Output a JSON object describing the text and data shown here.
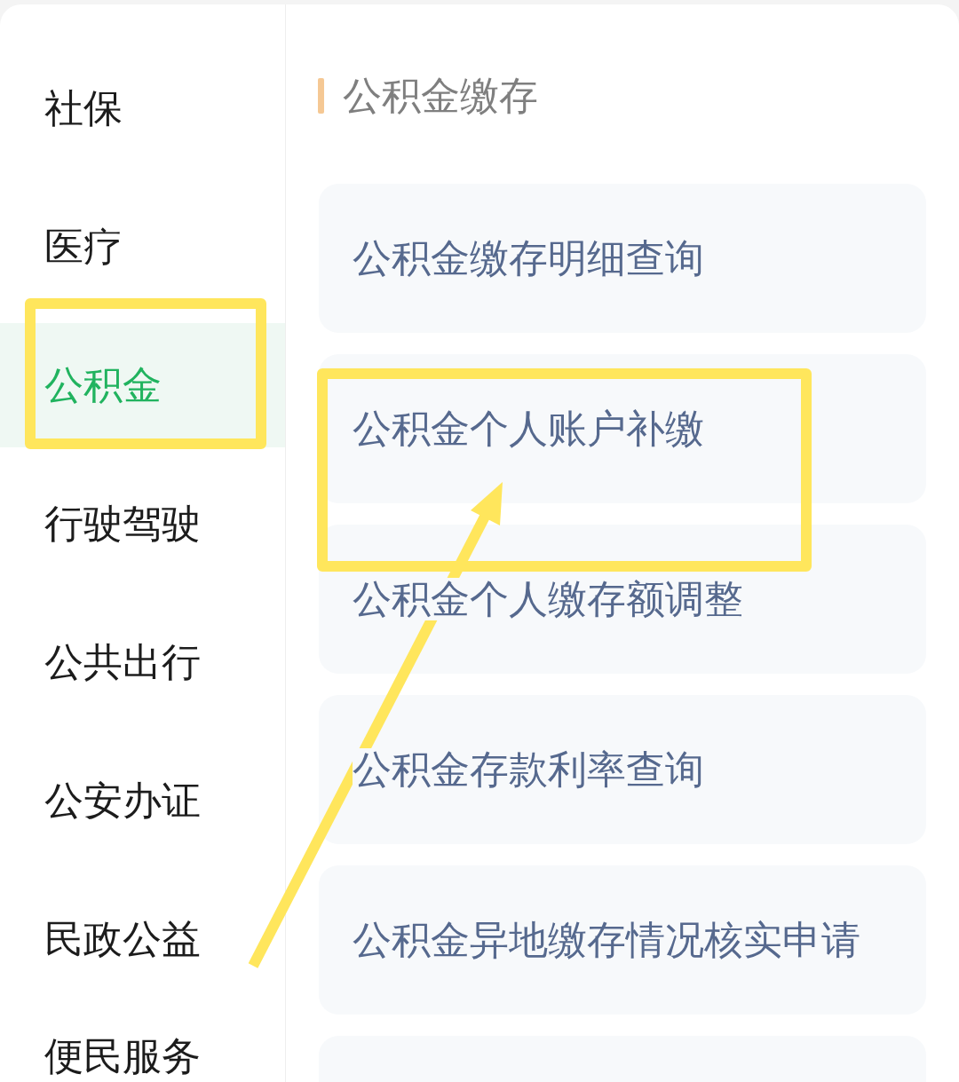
{
  "sidebar": {
    "items": [
      {
        "label": "社保",
        "selected": false,
        "highlighted": false
      },
      {
        "label": "医疗",
        "selected": false,
        "highlighted": false
      },
      {
        "label": "公积金",
        "selected": true,
        "highlighted": true
      },
      {
        "label": "行驶驾驶",
        "selected": false,
        "highlighted": false
      },
      {
        "label": "公共出行",
        "selected": false,
        "highlighted": false
      },
      {
        "label": "公安办证",
        "selected": false,
        "highlighted": false
      },
      {
        "label": "民政公益",
        "selected": false,
        "highlighted": false
      },
      {
        "label": "便民服务",
        "selected": false,
        "highlighted": false
      }
    ]
  },
  "section": {
    "title": "公积金缴存",
    "items": [
      {
        "label": "公积金缴存明细查询",
        "highlighted": false
      },
      {
        "label": "公积金个人账户补缴",
        "highlighted": true
      },
      {
        "label": "公积金个人缴存额调整",
        "highlighted": false
      },
      {
        "label": "公积金存款利率查询",
        "highlighted": false
      },
      {
        "label": "公积金异地缴存情况核实申请",
        "highlighted": false
      },
      {
        "highlighted": false
      }
    ]
  },
  "annotation_arrow": true
}
